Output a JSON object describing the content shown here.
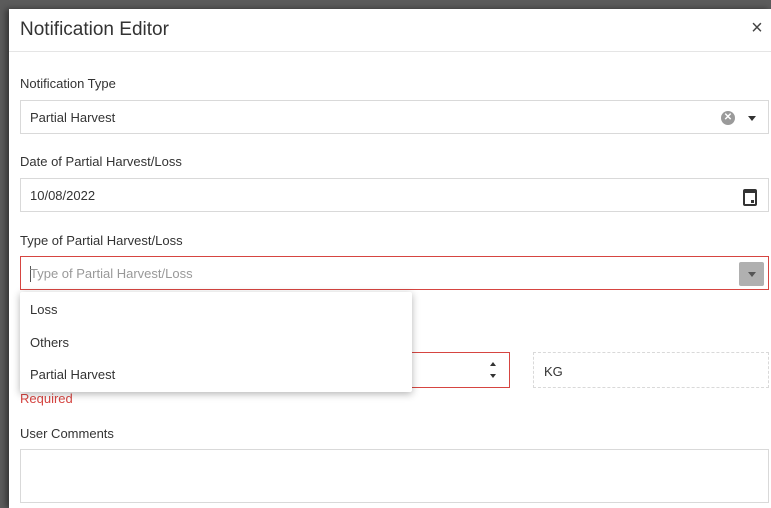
{
  "dialog": {
    "title": "Notification Editor",
    "close_glyph": "×"
  },
  "notification_type": {
    "label": "Notification Type",
    "value": "Partial Harvest",
    "clear_glyph": "✕"
  },
  "date": {
    "label": "Date of Partial Harvest/Loss",
    "value": "10/08/2022"
  },
  "harvest_type": {
    "label": "Type of Partial Harvest/Loss",
    "placeholder": "Type of Partial Harvest/Loss",
    "options": [
      "Loss",
      "Others",
      "Partial Harvest"
    ]
  },
  "quantity": {
    "unit": "KG",
    "error": "Required"
  },
  "comments": {
    "label": "User Comments",
    "value": ""
  },
  "colors": {
    "error": "#d64541",
    "border": "#d9d9d9",
    "overlay": "#5b5b5b"
  },
  "icons": {
    "close": "close-icon",
    "clear": "clear-circle-icon",
    "dropdown": "caret-down-icon",
    "calendar": "calendar-icon",
    "spinner": "spinner-arrows-icon"
  }
}
